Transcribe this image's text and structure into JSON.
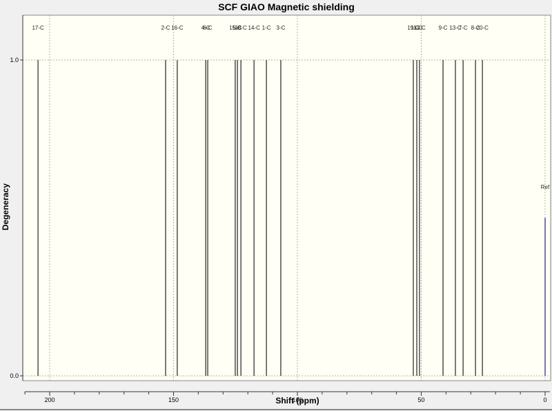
{
  "chart_data": {
    "type": "bar",
    "title": "SCF GIAO Magnetic shielding",
    "xlabel": "Shift (ppm)",
    "ylabel": "Degeneracy",
    "xlim": [
      210,
      -1
    ],
    "ylim": [
      0,
      1.0
    ],
    "x_ticks": [
      200,
      150,
      100,
      50,
      0
    ],
    "y_ticks": [
      "0.0",
      "1.0"
    ],
    "grid": true,
    "peaks": [
      {
        "label": "17-C",
        "shift": 204.7,
        "degeneracy": 1.0
      },
      {
        "label": "2-C",
        "shift": 153.2,
        "degeneracy": 1.0
      },
      {
        "label": "16-C",
        "shift": 148.5,
        "degeneracy": 1.0
      },
      {
        "label": "4-C",
        "shift": 137.0,
        "degeneracy": 1.0
      },
      {
        "label": "6-C",
        "shift": 136.2,
        "degeneracy": 1.0
      },
      {
        "label": "15-C",
        "shift": 125.1,
        "degeneracy": 1.0
      },
      {
        "label": "5-C",
        "shift": 124.2,
        "degeneracy": 1.0
      },
      {
        "label": "18-C",
        "shift": 122.8,
        "degeneracy": 1.0
      },
      {
        "label": "14-C",
        "shift": 117.5,
        "degeneracy": 1.0
      },
      {
        "label": "1-C",
        "shift": 112.5,
        "degeneracy": 1.0
      },
      {
        "label": "3-C",
        "shift": 106.7,
        "degeneracy": 1.0
      },
      {
        "label": "19-C",
        "shift": 53.2,
        "degeneracy": 1.0
      },
      {
        "label": "11-C",
        "shift": 51.8,
        "degeneracy": 1.0
      },
      {
        "label": "12-C",
        "shift": 50.7,
        "degeneracy": 1.0
      },
      {
        "label": "9-C",
        "shift": 41.2,
        "degeneracy": 1.0
      },
      {
        "label": "13-C",
        "shift": 36.2,
        "degeneracy": 1.0
      },
      {
        "label": "7-C",
        "shift": 33.1,
        "degeneracy": 1.0
      },
      {
        "label": "8-C",
        "shift": 28.1,
        "degeneracy": 1.0
      },
      {
        "label": "20-C",
        "shift": 25.3,
        "degeneracy": 1.0
      }
    ],
    "reference": {
      "label": "Ref",
      "shift": 0,
      "degeneracy": 0.5
    },
    "colors": {
      "peak": "#333333",
      "reference": "#4a4a9a",
      "plot_bg": "#fffff5",
      "grid": "#b0b0a0"
    }
  }
}
